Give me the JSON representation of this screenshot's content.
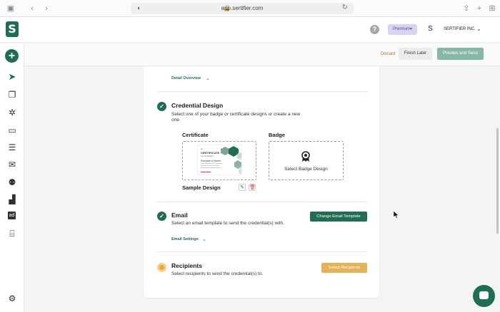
{
  "browser": {
    "url": "app.sertifier.com"
  },
  "header": {
    "logo_letter": "S",
    "help_label": "?",
    "plan_badge": "Premium",
    "org_initial": "S",
    "org_name": "SERTIFIER INC."
  },
  "toolbar": {
    "discard_label": "Discard",
    "finish_later_label": "Finish Later",
    "preview_send_label": "Preview and Send"
  },
  "sidebar": {
    "items": [
      {
        "icon": "plus-icon"
      },
      {
        "icon": "send-icon"
      },
      {
        "icon": "copy-icon"
      },
      {
        "icon": "gear-puzzle-icon"
      },
      {
        "icon": "monitor-icon"
      },
      {
        "icon": "list-icon"
      },
      {
        "icon": "mail-icon"
      },
      {
        "icon": "users-icon"
      },
      {
        "icon": "bar-chart-icon"
      },
      {
        "icon": "ad-icon",
        "label": "ad"
      },
      {
        "icon": "gift-icon"
      },
      {
        "icon": "settings-icon"
      }
    ]
  },
  "steps": {
    "detail_overview_label": "Detail Overview",
    "credential_design": {
      "title": "Credential Design",
      "description": "Select one of your badge or certificate designs or create a new one.",
      "certificate_label": "Certificate",
      "badge_label": "Badge",
      "select_badge_label": "Select Badge Design",
      "sample_design_name": "Sample Design",
      "certificate_thumbnail": {
        "heading": "CERTIFICATE",
        "subheading": "of completion",
        "recipient": "Recipient Name"
      }
    },
    "email": {
      "title": "Email",
      "description": "Select an email template to send the credential(s) with.",
      "button_label": "Change Email Template",
      "settings_label": "Email Settings"
    },
    "recipients": {
      "title": "Recipients",
      "description": "Select recipients to send the credential(s) to.",
      "button_label": "Select Recipients"
    }
  },
  "colors": {
    "brand_green": "#1f6e51",
    "preview_button": "#86b8a8",
    "recipients_button": "#e6b255",
    "premium_badge": "#d9d2f2",
    "discard_text": "#b36b2a"
  }
}
